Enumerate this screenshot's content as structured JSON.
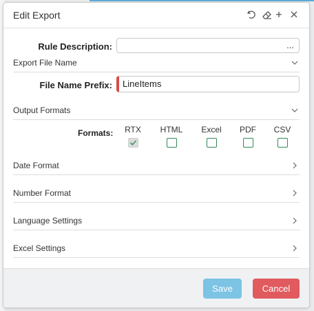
{
  "dialog": {
    "title": "Edit Export",
    "icons": [
      "undo-icon",
      "eraser-icon",
      "plus-icon",
      "close-icon"
    ]
  },
  "rule_description": {
    "label": "Rule Description:",
    "value": "",
    "button": "..."
  },
  "sections": {
    "export_file_name": "Export File Name",
    "output_formats": "Output Formats",
    "date_format": "Date Format",
    "number_format": "Number Format",
    "language_settings": "Language Settings",
    "excel_settings": "Excel Settings"
  },
  "file_name_prefix": {
    "label": "File Name Prefix:",
    "value": "LineItems"
  },
  "formats": {
    "label": "Formats:",
    "options": [
      {
        "name": "RTX",
        "checked": true
      },
      {
        "name": "HTML",
        "checked": false
      },
      {
        "name": "Excel",
        "checked": false
      },
      {
        "name": "PDF",
        "checked": false
      },
      {
        "name": "CSV",
        "checked": false
      }
    ]
  },
  "footer": {
    "save": "Save",
    "cancel": "Cancel"
  },
  "colors": {
    "save": "#7cc3e4",
    "cancel": "#e05a5e",
    "required": "#d74a4a",
    "checkbox_border": "#2f8a52",
    "accent": "#5aa9d6"
  }
}
